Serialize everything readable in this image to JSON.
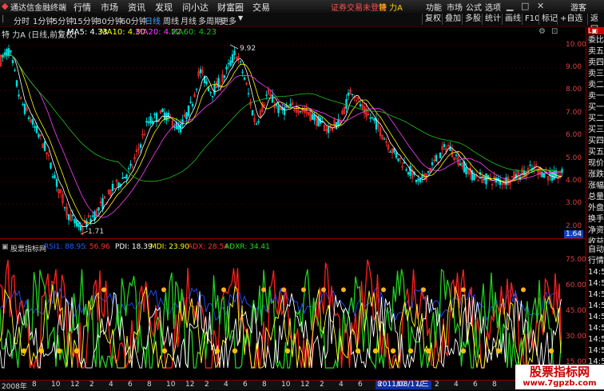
{
  "app": {
    "title": "通达信金融终端",
    "menu": [
      "行情",
      "市场",
      "资讯",
      "发现",
      "问小达",
      "财富圈",
      "交易"
    ],
    "login_text": "证券交易未登录",
    "stock_name": "特 力A",
    "right_menu": [
      "功能",
      "市场",
      "公式",
      "选项"
    ],
    "guest": "游客"
  },
  "periods": [
    "分时",
    "1分钟",
    "5分钟",
    "15分钟",
    "30分钟",
    "60分钟",
    "日线",
    "周线",
    "月线",
    "多周期",
    "更多"
  ],
  "tools": [
    "复权",
    "叠加",
    "多股",
    "统计",
    "画线",
    "F10",
    "标记",
    "+自选",
    "返回"
  ],
  "info": {
    "title": "特 力A (日线,前复权)",
    "ma5": "MA5: 4.33",
    "ma10": "MA10: 4.30",
    "ma20": "MA20: 4.22",
    "ma60": "MA60: 4.23"
  },
  "price_axis": [
    "10.00",
    "9.00",
    "8.00",
    "7.00",
    "6.00",
    "5.00",
    "4.00",
    "3.00",
    "2.00"
  ],
  "price_current": "1.64",
  "annotations": {
    "high": "9.92",
    "low": "1.71"
  },
  "ind_info": {
    "title": "股票指标网",
    "label1": "RSI1: 88.95",
    "label2": ": 56.96",
    "pdi": "PDI: 18.39",
    "mdi": "MDI: 23.90",
    "adx": "ADX: 28.54",
    "adxr": "ADXR: 34.41"
  },
  "ind_axis": [
    "75.00",
    "60.00",
    "45.00",
    "30.00",
    "15.00"
  ],
  "side_labels": [
    "委比",
    "卖五",
    "卖四",
    "卖三",
    "卖二",
    "卖一",
    "买一",
    "买二",
    "买三",
    "买四",
    "买五",
    "现价",
    "涨跌",
    "涨幅",
    "总量",
    "外盘",
    "换手",
    "净资",
    "收益"
  ],
  "side_labels2": [
    "自动",
    "行情",
    "14:5",
    "14:5",
    "14:5",
    "14:5",
    "14:5",
    "14:5",
    "14:5",
    "14:5",
    "14:5",
    "14:5"
  ],
  "bottom": {
    "year": "2008年",
    "ticks": [
      "8",
      "10",
      "12",
      "2",
      "4",
      "6",
      "8",
      "10",
      "12",
      "2",
      "4",
      "6",
      "8",
      "10",
      "12",
      "2",
      "4",
      "6",
      "8",
      "10",
      "12",
      "2",
      "4",
      "6",
      "8",
      "10",
      "12"
    ],
    "date_badge": "2011/08/17/三"
  },
  "watermark": {
    "line1": "股票指标网",
    "line2": "www.7gpzb.com"
  },
  "colors": {
    "up": "#ff3030",
    "down": "#00e0e0",
    "ma5": "#ffffff",
    "ma10": "#ffff00",
    "ma20": "#ff40ff",
    "ma60": "#20c020",
    "accent": "#ff2020"
  }
}
